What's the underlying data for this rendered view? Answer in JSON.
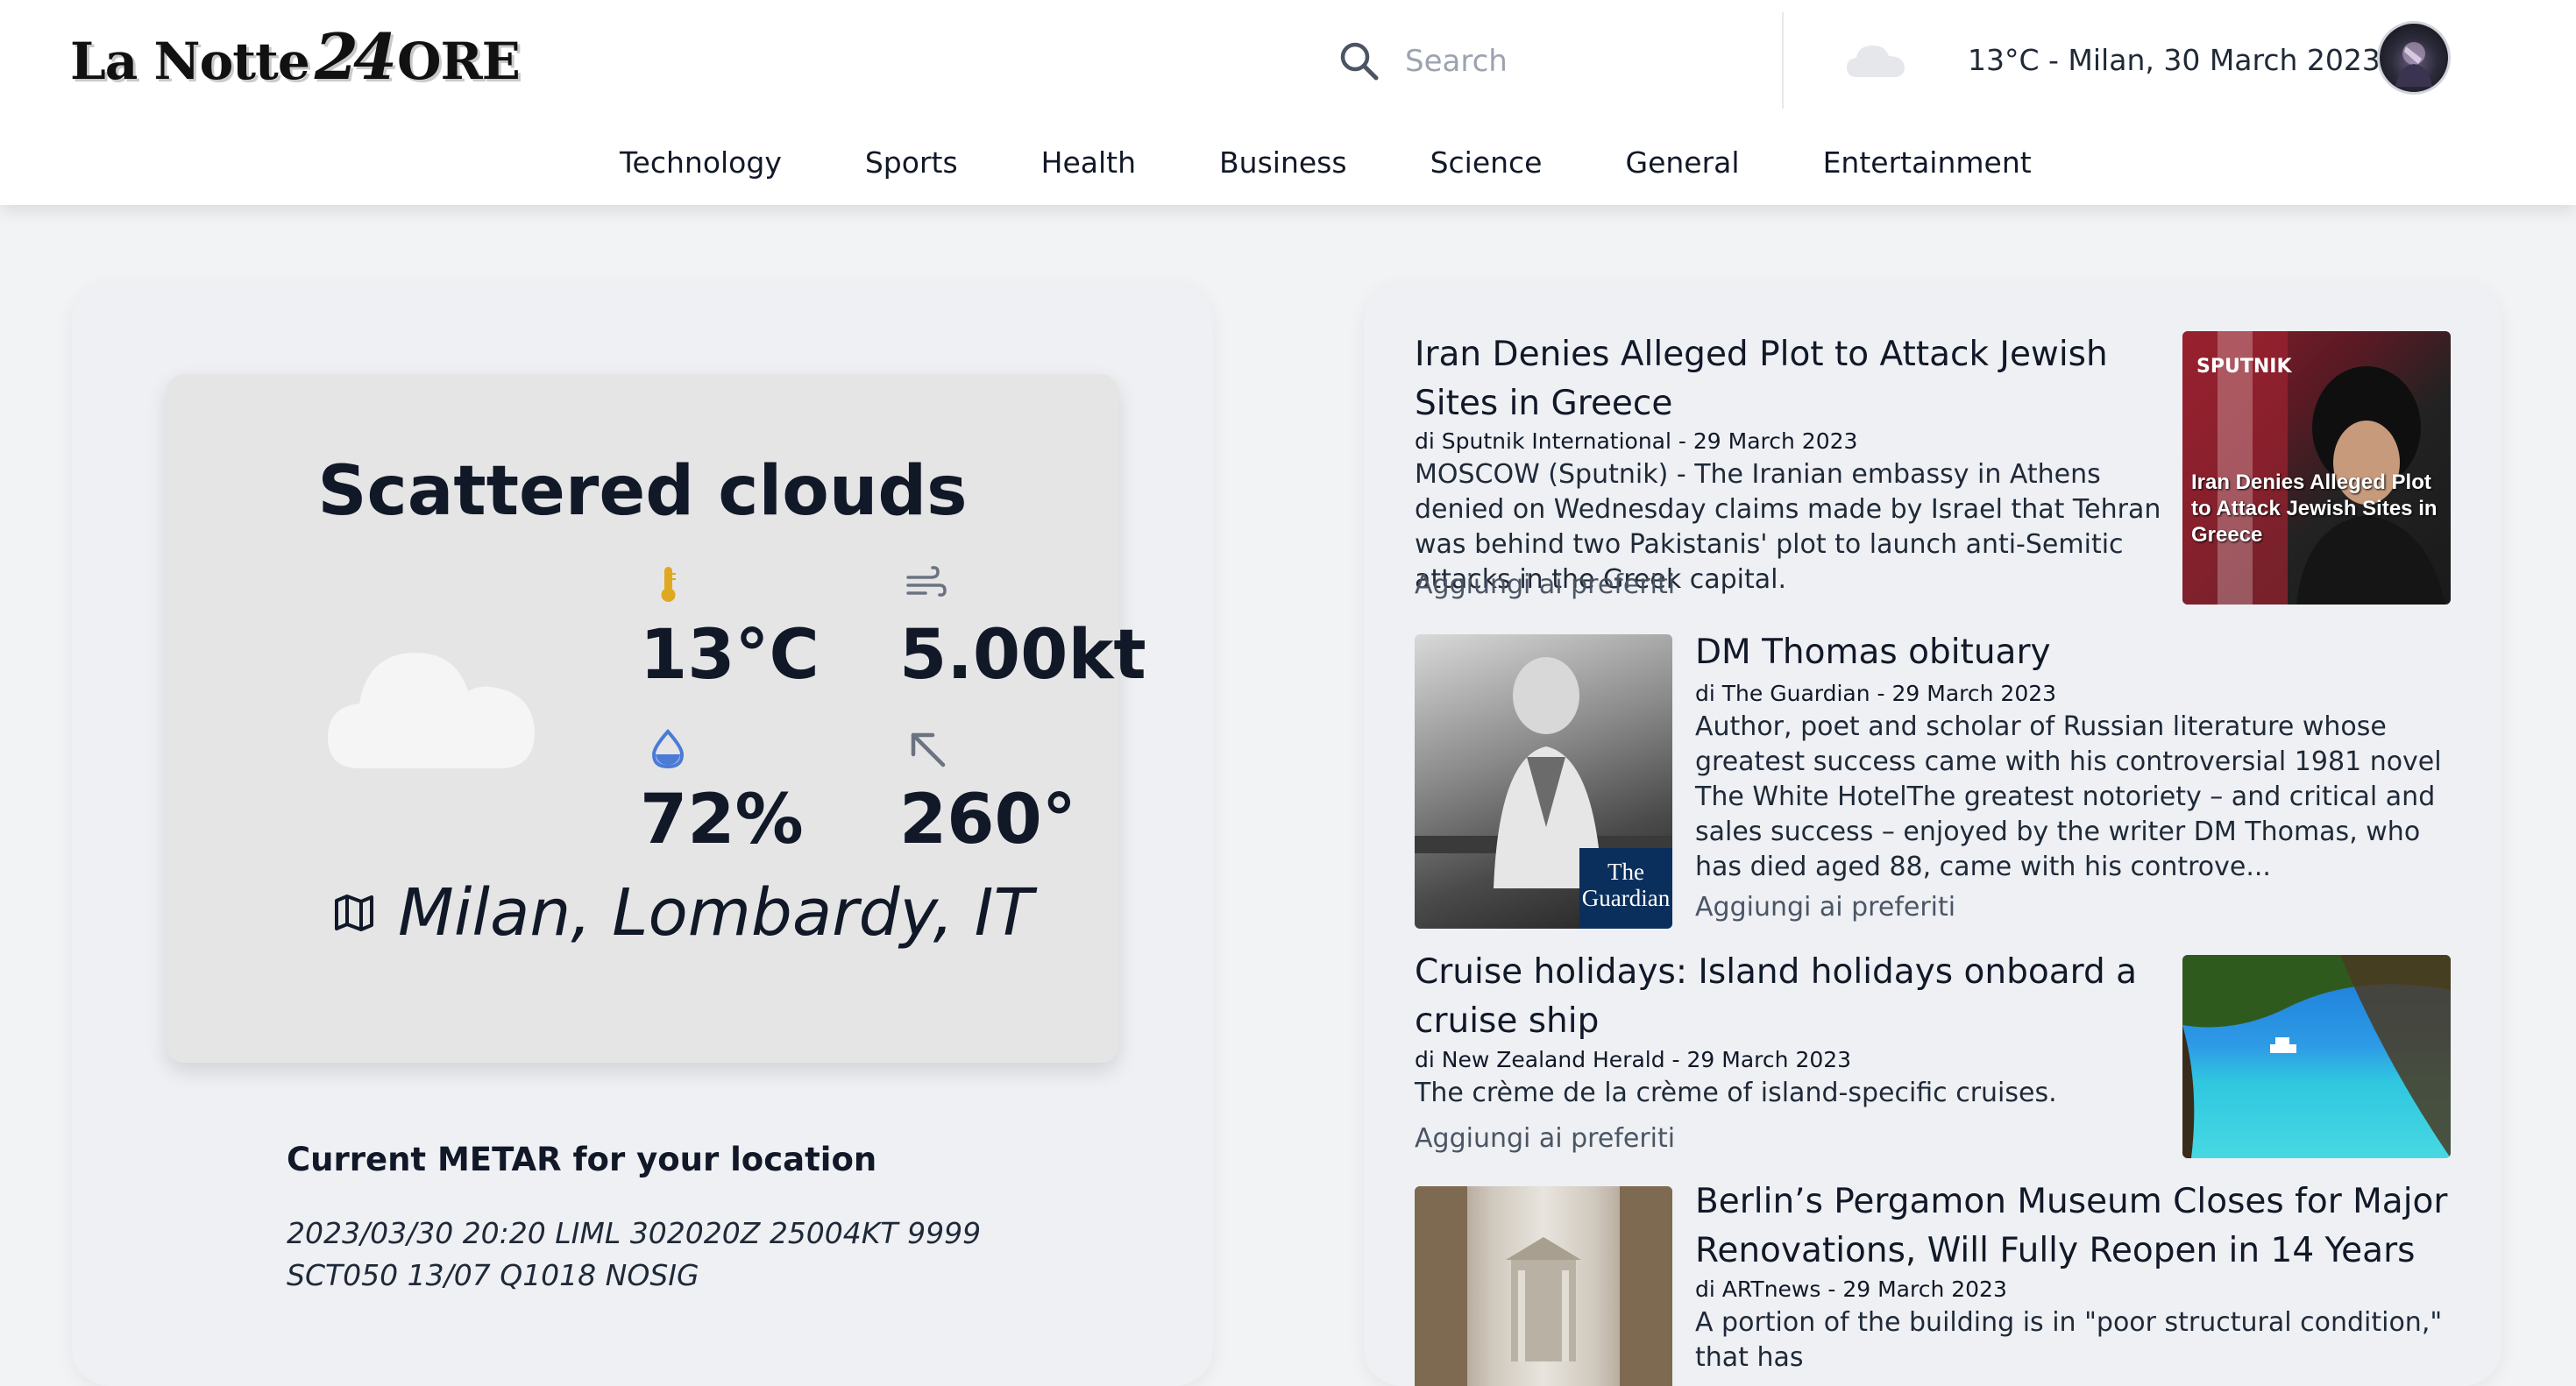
{
  "header": {
    "logo_text_1": "La Notte",
    "logo_text_num": "24",
    "logo_text_2": "ORE",
    "search_placeholder": "Search",
    "weather_summary": "13°C - Milan, 30 March 2023"
  },
  "nav": {
    "items": [
      "Technology",
      "Sports",
      "Health",
      "Business",
      "Science",
      "General",
      "Entertainment"
    ]
  },
  "weather": {
    "condition": "Scattered clouds",
    "temperature": "13°C",
    "wind_speed": "5.00kt",
    "humidity": "72%",
    "wind_direction": "260°",
    "location": "Milan, Lombardy, IT",
    "metar_title": "Current METAR for your location",
    "metar_text": "2023/03/30 20:20 LIML 302020Z 25004KT 9999 SCT050 13/07 Q1018 NOSIG"
  },
  "news": {
    "by_prefix": "di",
    "articles": [
      {
        "title": "Iran Denies Alleged Plot to Attack Jewish Sites in Greece",
        "source": "Sputnik International",
        "date": "29 March 2023",
        "description": "MOSCOW (Sputnik) - The Iranian embassy in Athens denied on Wednesday claims made by Israel that Tehran was behind two Pakistanis' plot to launch anti-Semitic attacks in the Greek capital.",
        "favorite_label": "Aggiungi ai preferiti",
        "image_brand": "SPUTNIK",
        "image_caption": "Iran Denies Alleged Plot to Attack Jewish Sites in Greece"
      },
      {
        "title": "DM Thomas obituary",
        "source": "The Guardian",
        "date": "29 March 2023",
        "description": "Author, poet and scholar of Russian literature whose greatest success came with his controversial 1981 novel The White HotelThe greatest notoriety – and critical and sales success – enjoyed by the writer DM Thomas, who has died aged 88, came with his controve...",
        "favorite_label": "Aggiungi ai preferiti",
        "image_badge": "The Guardian"
      },
      {
        "title": "Cruise holidays: Island holidays onboard a cruise ship",
        "source": "New Zealand Herald",
        "date": "29 March 2023",
        "description": "The crème de la crème of island-specific cruises.",
        "favorite_label": "Aggiungi ai preferiti"
      },
      {
        "title": "Berlin’s Pergamon Museum Closes for Major Renovations, Will Fully Reopen in 14 Years",
        "source": "ARTnews",
        "date": "29 March 2023",
        "description": "A portion of the building is in \"poor structural condition,\" that has"
      }
    ]
  },
  "colors": {
    "thermometer": "#e0a81e",
    "humidity_drop": "#4a7bd6",
    "icon_gray": "#6b7280",
    "cloud": "#f5f5f5"
  }
}
